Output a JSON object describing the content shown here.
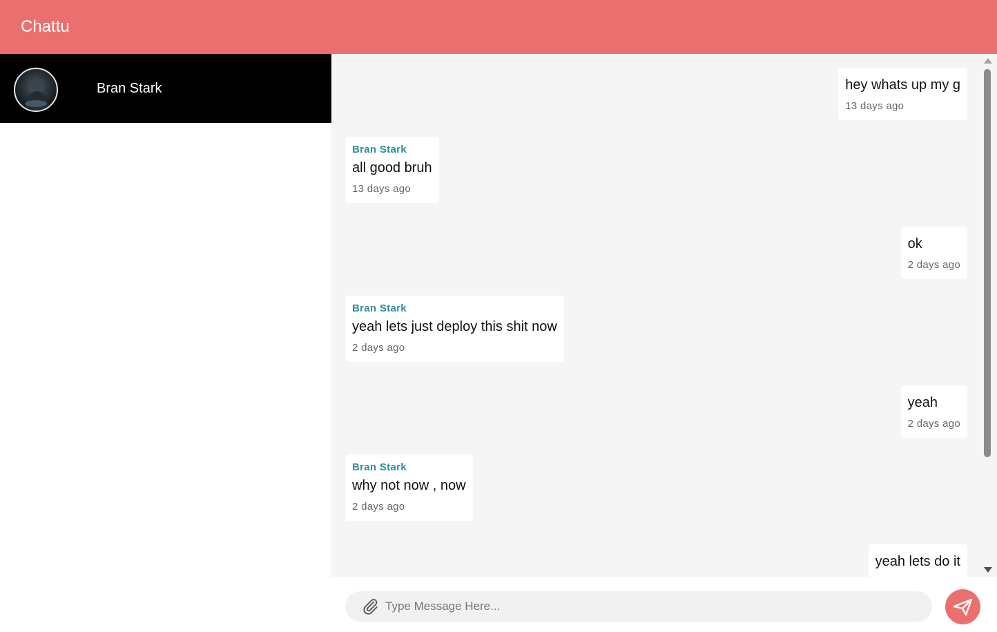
{
  "app": {
    "title": "Chattu",
    "accent_color": "#ec6f6f"
  },
  "sidebar": {
    "contacts": [
      {
        "name": "Bran Stark",
        "avatar_icon": "user-avatar-photo"
      }
    ]
  },
  "chat": {
    "messages": [
      {
        "direction": "out",
        "sender": "",
        "text": "hey whats up my g",
        "time": "13 days ago"
      },
      {
        "direction": "in",
        "sender": "Bran Stark",
        "text": "all good bruh",
        "time": "13 days ago"
      },
      {
        "direction": "out",
        "sender": "",
        "text": "ok",
        "time": "2 days ago"
      },
      {
        "direction": "in",
        "sender": "Bran Stark",
        "text": "yeah lets just deploy this shit now",
        "time": "2 days ago"
      },
      {
        "direction": "out",
        "sender": "",
        "text": "yeah",
        "time": "2 days ago"
      },
      {
        "direction": "in",
        "sender": "Bran Stark",
        "text": "why not now , now",
        "time": "2 days ago"
      },
      {
        "direction": "out",
        "sender": "",
        "text": "yeah lets do it",
        "time": ""
      }
    ]
  },
  "composer": {
    "placeholder": "Type Message Here...",
    "value": "",
    "attach_icon": "paperclip-icon",
    "send_icon": "paper-plane-icon"
  }
}
